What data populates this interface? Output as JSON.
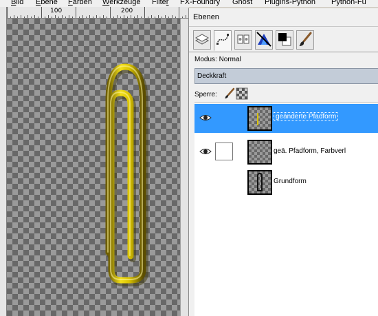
{
  "menubar": {
    "items": [
      {
        "label": "Bild",
        "ul": "B"
      },
      {
        "label": "Ebene",
        "ul": "E"
      },
      {
        "label": "Farben",
        "ul": "F"
      },
      {
        "label": "Werkzeuge",
        "ul": "W"
      },
      {
        "label": "Filter",
        "ul": "r"
      },
      {
        "label": "FX-Foundry",
        "ul": ""
      },
      {
        "label": "Ghost",
        "ul": ""
      },
      {
        "label": "Plugins-Python",
        "ul": ""
      },
      {
        "label": "Python-Fu",
        "ul": ""
      }
    ]
  },
  "ruler": {
    "labels": [
      "100",
      "200"
    ]
  },
  "dock": {
    "title": "Ebenen",
    "mode_label": "Modus: Normal",
    "opacity_label": "Deckkraft",
    "lock_label": "Sperre:"
  },
  "layers": [
    {
      "name": "geänderte Pfadform",
      "selected": true,
      "visible": true
    },
    {
      "name": "geä. Pfadform, Farbverl",
      "selected": false,
      "visible": true
    },
    {
      "name": "Grundform",
      "selected": false,
      "visible": false
    }
  ],
  "colors": {
    "selection": "#3399ff",
    "clip_gold": "#d9c200",
    "opacity_bar": "#c3ccd8"
  }
}
